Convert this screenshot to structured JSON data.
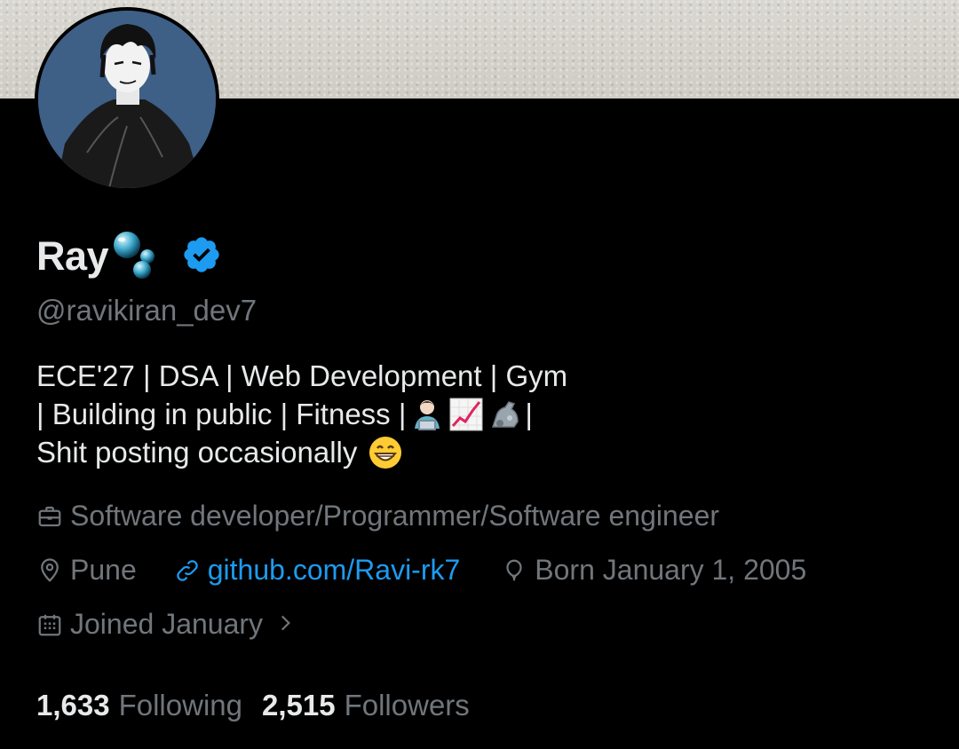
{
  "profile": {
    "display_name": "Ray",
    "handle": "@ravikiran_dev7",
    "bio_lines": [
      "ECE'27 | DSA | Web Development | Gym",
      "| Building in public | Fitness |",
      "Shit posting occasionally"
    ],
    "bio_line2_suffix": "|",
    "name_emoji": "bubbles",
    "bio_emojis": [
      "technologist",
      "chart-increasing",
      "mechanical-arm",
      "grinning-face"
    ]
  },
  "meta": {
    "profession": "Software developer/Programmer/Software engineer",
    "location": "Pune",
    "website": "github.com/Ravi-rk7",
    "birthday": "Born January 1, 2005",
    "joined": "Joined January"
  },
  "stats": {
    "following_count": "1,633",
    "following_label": "Following",
    "followers_count": "2,515",
    "followers_label": "Followers"
  },
  "colors": {
    "background": "#000000",
    "text_primary": "#e7e9ea",
    "text_secondary": "#71767b",
    "link": "#1d9bf0",
    "verified_badge": "#1d9bf0",
    "avatar_bg": "#3e5f86"
  },
  "icons": {
    "profession": "briefcase-icon",
    "location": "location-pin-icon",
    "website": "link-icon",
    "birthday": "balloon-icon",
    "joined": "calendar-icon",
    "joined_more": "chevron-right-icon",
    "verified": "verified-badge-icon"
  }
}
